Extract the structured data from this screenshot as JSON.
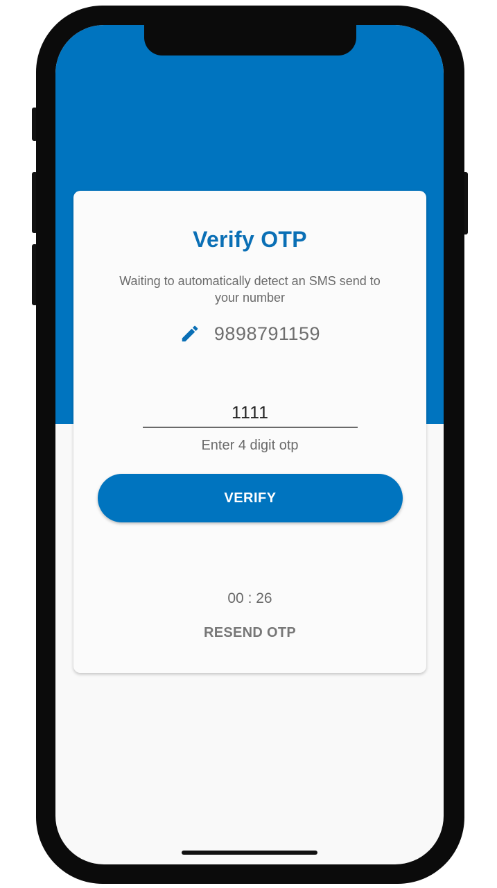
{
  "card": {
    "title": "Verify OTP",
    "subtitle": "Waiting to automatically detect an SMS send to your number",
    "phone_number": "9898791159",
    "otp_value": "1111",
    "otp_hint": "Enter 4 digit otp",
    "verify_label": "VERIFY",
    "timer": "00 : 26",
    "resend_label": "RESEND OTP"
  },
  "icons": {
    "edit": "pencil-icon"
  },
  "colors": {
    "primary": "#0074bf",
    "title": "#0a6fb5",
    "text_muted": "#6a6a6a",
    "background": "#f9f9f9"
  }
}
